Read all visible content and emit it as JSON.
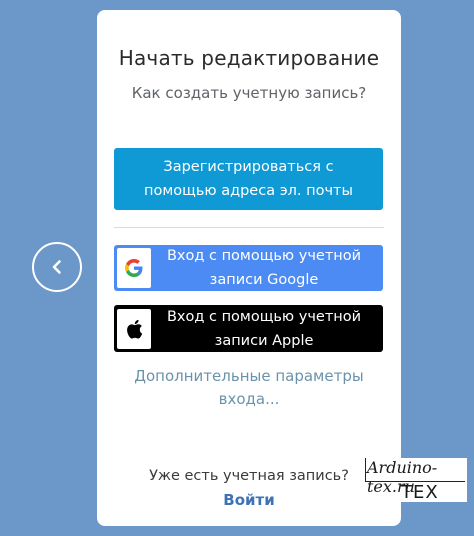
{
  "dialog": {
    "title": "Начать редактирование",
    "subtitle": "Как создать учетную запись?"
  },
  "buttons": {
    "email": "Зарегистрироваться с помощью адреса эл. почты",
    "google": "Вход с помощью учетной записи Google",
    "apple": "Вход с помощью учетной записи Apple"
  },
  "more_options": "Дополнительные параметры входа...",
  "footer": {
    "have_account": "Уже есть учетная запись?",
    "login": "Войти"
  },
  "watermark": {
    "site": "Arduino-tex.ru",
    "brand": "ТЕХ"
  },
  "icons": {
    "back": "chevron-left-icon",
    "google": "google-logo-icon",
    "apple": "apple-logo-icon"
  },
  "colors": {
    "background": "#6b98c9",
    "email_button": "#0f9ad6",
    "google_button": "#4c8bf4",
    "apple_button": "#000000",
    "link": "#3d72b4"
  }
}
